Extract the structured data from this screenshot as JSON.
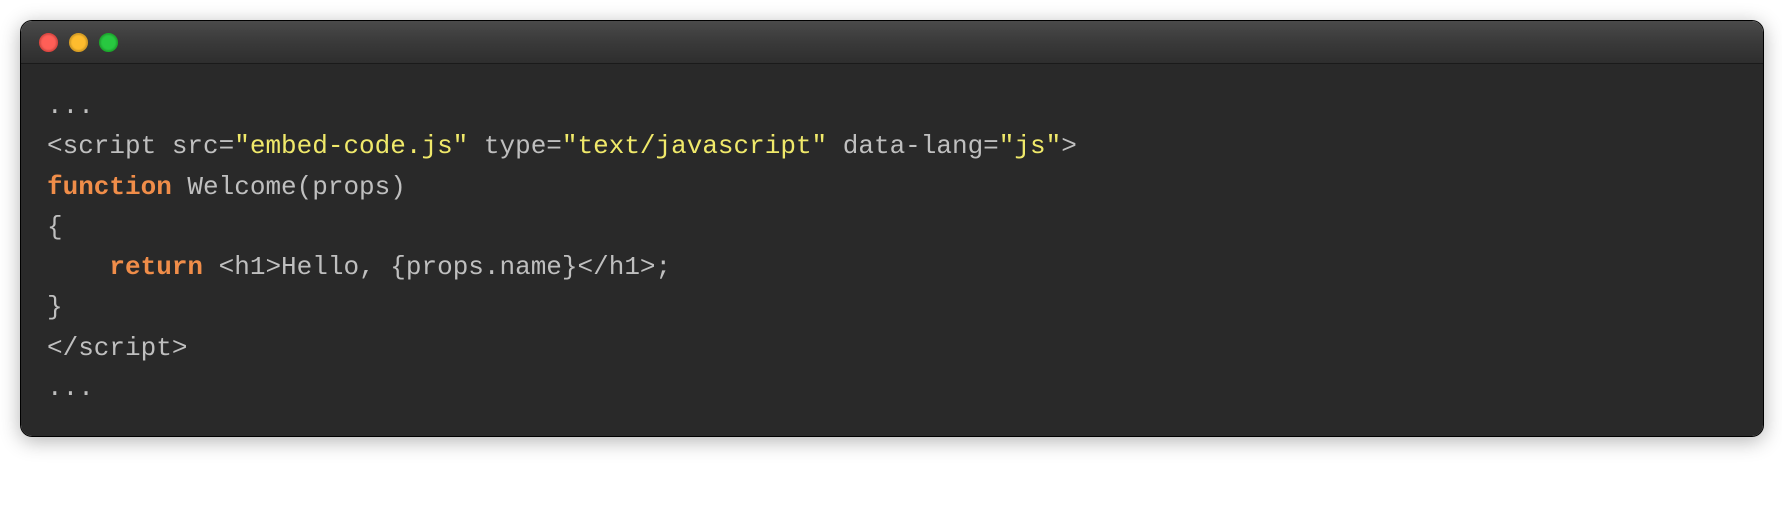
{
  "code": {
    "ellipsis_top": "...",
    "line1": {
      "open": "<script src=",
      "src_val": "\"embed-code.js\"",
      "type_attr": " type=",
      "type_val": "\"text/javascript\"",
      "data_attr": " data-lang=",
      "data_val": "\"js\"",
      "close": ">"
    },
    "line2": {
      "kw_function": "function",
      "rest": " Welcome(props)"
    },
    "line3": "{",
    "line4": {
      "indent": "    ",
      "kw_return": "return",
      "rest": " <h1>Hello, {props.name}</h1>;"
    },
    "line5": "}",
    "line6": "</script>",
    "ellipsis_bottom": "..."
  },
  "colors": {
    "background": "#292929",
    "string": "#f0e96a",
    "keyword": "#f08d49",
    "default": "#bfbfbf"
  }
}
